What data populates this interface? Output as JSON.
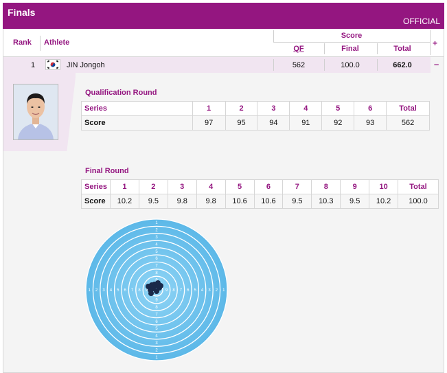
{
  "header": {
    "title": "Finals",
    "status": "OFFICIAL"
  },
  "columns": {
    "rank": "Rank",
    "athlete": "Athlete",
    "score_group": "Score",
    "qf": "QF",
    "final": "Final",
    "total": "Total",
    "expand": "+"
  },
  "athlete": {
    "rank": "1",
    "name": "JIN Jongoh",
    "qf": "562",
    "final": "100.0",
    "total": "662.0",
    "collapse": "–"
  },
  "qualification": {
    "title": "Qualification Round",
    "series_label": "Series",
    "score_label": "Score",
    "total_label": "Total",
    "series": [
      "1",
      "2",
      "3",
      "4",
      "5",
      "6"
    ],
    "scores": [
      "97",
      "95",
      "94",
      "91",
      "92",
      "93"
    ],
    "total": "562"
  },
  "final_round": {
    "title": "Final Round",
    "series_label": "Series",
    "score_label": "Score",
    "total_label": "Total",
    "series": [
      "1",
      "2",
      "3",
      "4",
      "5",
      "6",
      "7",
      "8",
      "9",
      "10"
    ],
    "scores": [
      "10.2",
      "9.5",
      "9.8",
      "9.8",
      "10.6",
      "10.6",
      "9.5",
      "10.3",
      "9.5",
      "10.2"
    ],
    "total": "100.0"
  },
  "target": {
    "ring_numbers": [
      "1",
      "2",
      "3",
      "4",
      "5",
      "6",
      "7",
      "8",
      "9"
    ]
  },
  "colors": {
    "brand": "#941680",
    "target_blue": "#6fc3ee",
    "shot": "#1a2a4a"
  }
}
